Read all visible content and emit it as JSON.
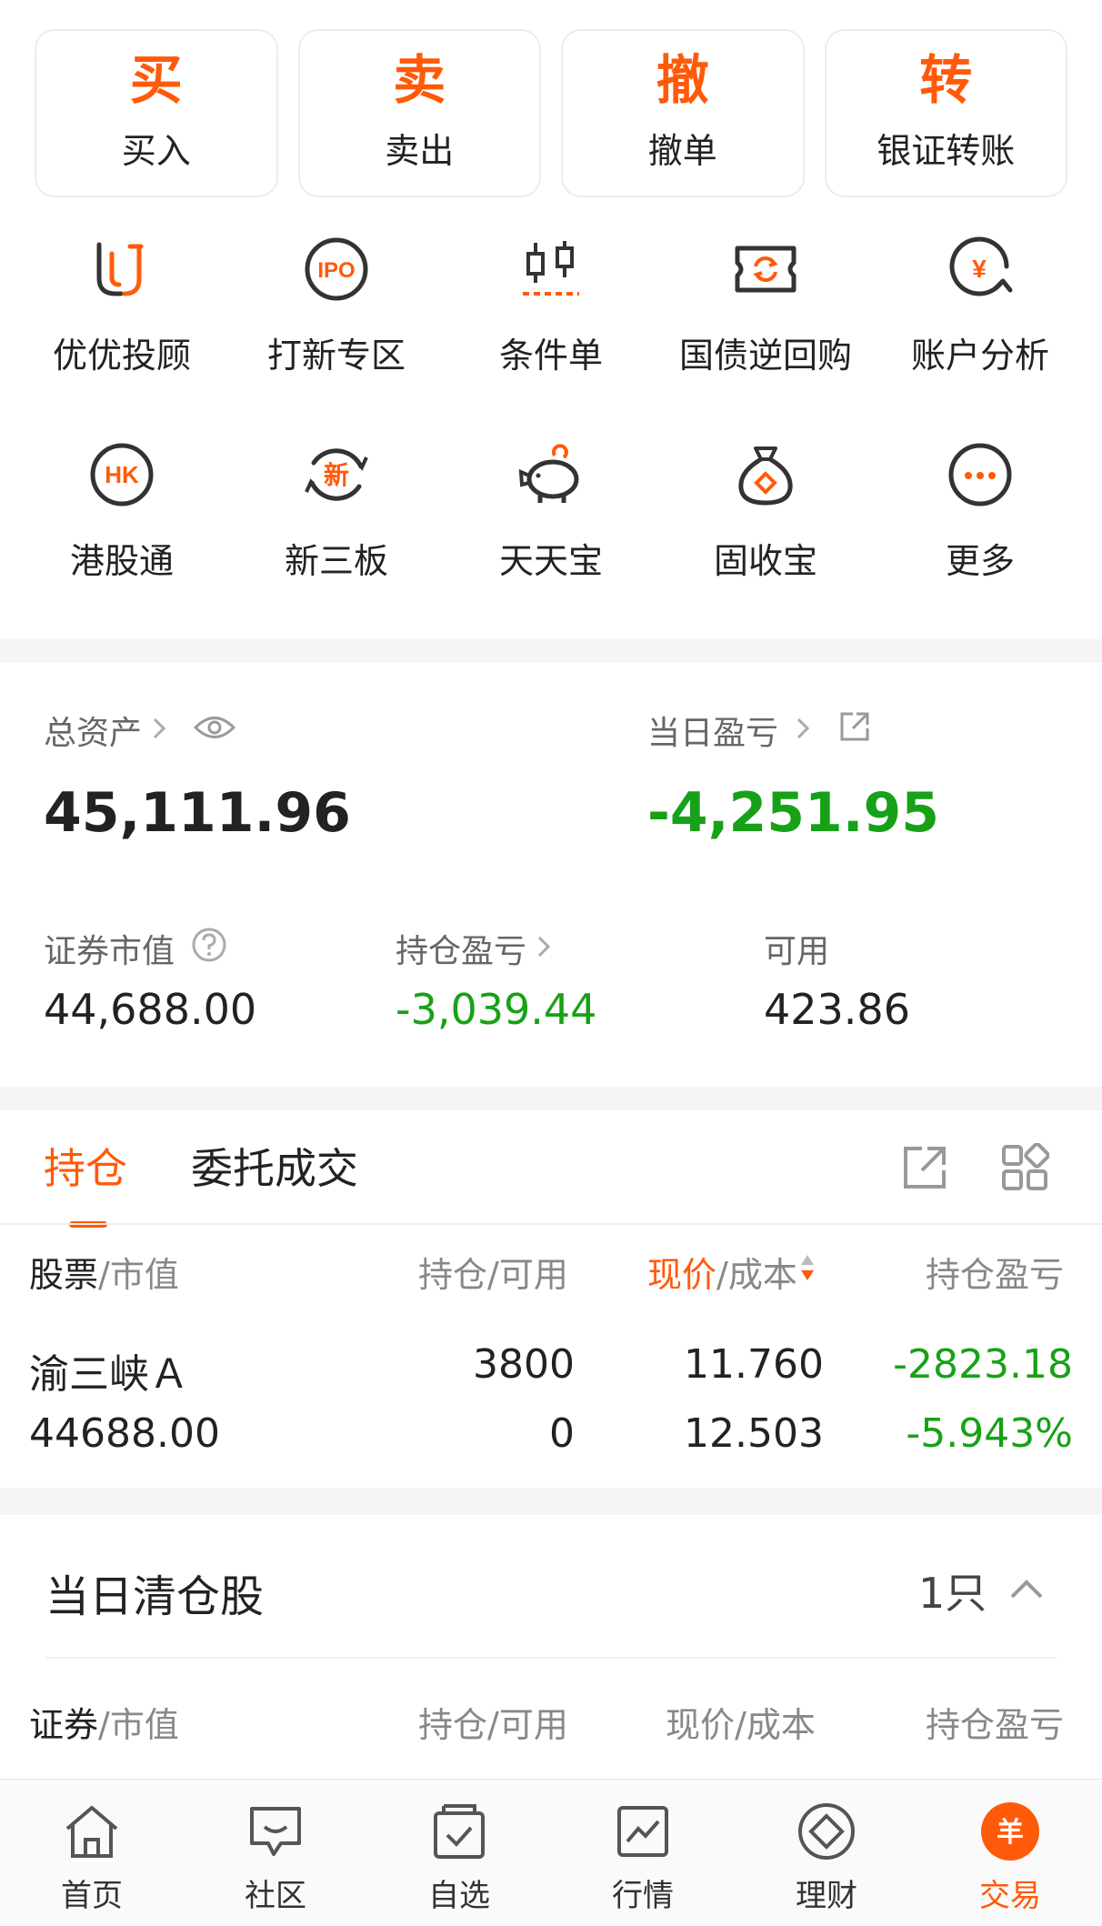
{
  "trade_buttons": [
    {
      "glyph": "买",
      "label": "买入"
    },
    {
      "glyph": "卖",
      "label": "卖出"
    },
    {
      "glyph": "撤",
      "label": "撤单"
    },
    {
      "glyph": "转",
      "label": "银证转账"
    }
  ],
  "features": [
    {
      "icon": "u-logo-icon",
      "label": "优优投顾"
    },
    {
      "icon": "ipo-icon",
      "label": "打新专区"
    },
    {
      "icon": "candlestick-icon",
      "label": "条件单"
    },
    {
      "icon": "repo-ticket-icon",
      "label": "国债逆回购"
    },
    {
      "icon": "yuan-analysis-icon",
      "label": "账户分析"
    },
    {
      "icon": "hk-icon",
      "label": "港股通"
    },
    {
      "icon": "new-board-icon",
      "label": "新三板"
    },
    {
      "icon": "piggy-bank-icon",
      "label": "天天宝"
    },
    {
      "icon": "money-bag-icon",
      "label": "固收宝"
    },
    {
      "icon": "more-icon",
      "label": "更多"
    }
  ],
  "icon_text": {
    "ipo": "IPO",
    "hk": "HK",
    "new": "新",
    "yuan": "¥",
    "more": "···"
  },
  "assets": {
    "total_label": "总资产",
    "total_value": "45,111.96",
    "daily_pl_label": "当日盈亏",
    "daily_pl_value": "-4,251.95",
    "market_value_label": "证券市值",
    "market_value": "44,688.00",
    "position_pl_label": "持仓盈亏",
    "position_pl_value": "-3,039.44",
    "available_label": "可用",
    "available_value": "423.86"
  },
  "holdings": {
    "tabs": [
      "持仓",
      "委托成交"
    ],
    "columns": [
      {
        "main": "股票",
        "sub": "/市值"
      },
      {
        "main": "持仓",
        "sub": "/可用"
      },
      {
        "main": "现价",
        "sub": "/成本"
      },
      {
        "main": "持仓盈亏",
        "sub": ""
      }
    ],
    "rows": [
      {
        "name": "渝三峡Ａ",
        "market_value": "44688.00",
        "position": "3800",
        "available": "0",
        "price": "11.760",
        "cost": "12.503",
        "pl": "-2823.18",
        "pl_pct": "-5.943%"
      }
    ]
  },
  "cleared": {
    "title": "当日清仓股",
    "count": "1只",
    "columns": [
      {
        "main": "证券",
        "sub": "/市值"
      },
      {
        "main": "持仓",
        "sub": "/可用"
      },
      {
        "main": "现价",
        "sub": "/成本"
      },
      {
        "main": "持仓盈亏",
        "sub": ""
      }
    ]
  },
  "nav": [
    {
      "label": "首页",
      "icon": "home-icon"
    },
    {
      "label": "社区",
      "icon": "community-icon"
    },
    {
      "label": "自选",
      "icon": "watchlist-icon"
    },
    {
      "label": "行情",
      "icon": "market-icon"
    },
    {
      "label": "理财",
      "icon": "wealth-icon"
    },
    {
      "label": "交易",
      "icon": "trade-icon"
    }
  ],
  "nav_trade_glyph": "羊",
  "colors": {
    "accent": "#ff5a0a",
    "loss": "#17a117",
    "text": "#222222",
    "muted": "#888888"
  }
}
